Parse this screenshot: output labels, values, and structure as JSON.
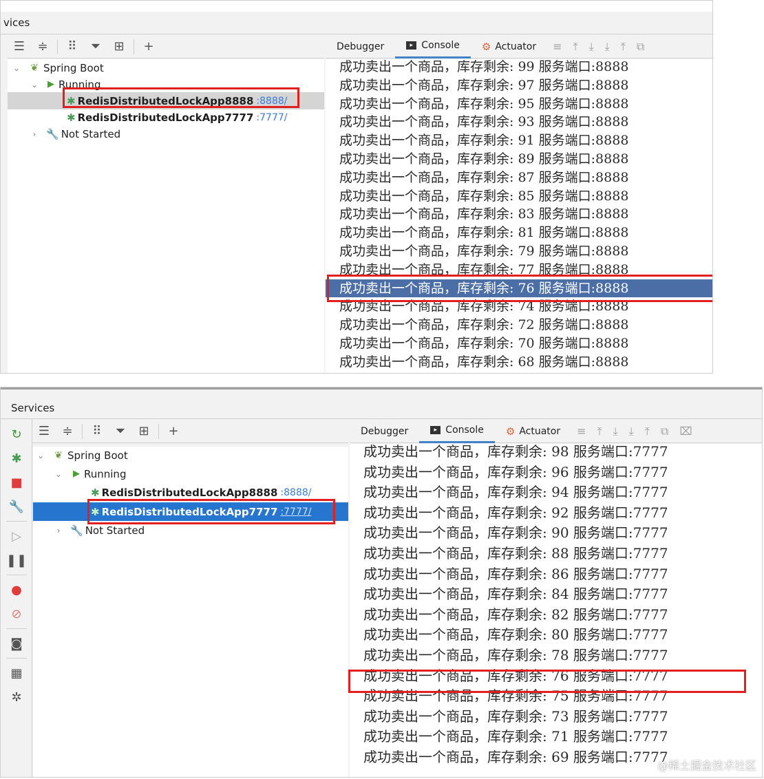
{
  "top": {
    "title": "vices",
    "tree": {
      "spring_boot": "Spring Boot",
      "running": "Running",
      "app1_name": "RedisDistributedLockApp8888",
      "app1_port": ":8888/",
      "app2_name": "RedisDistributedLockApp7777",
      "app2_port": ":7777/",
      "not_started": "Not Started"
    },
    "tabs": {
      "debugger": "Debugger",
      "console": "Console",
      "actuator": "Actuator"
    },
    "console_lines": [
      "成功卖出一个商品，库存剩余: 99 服务端口:8888",
      "成功卖出一个商品，库存剩余: 97 服务端口:8888",
      "成功卖出一个商品，库存剩余: 95 服务端口:8888",
      "成功卖出一个商品，库存剩余: 93 服务端口:8888",
      "成功卖出一个商品，库存剩余: 91 服务端口:8888",
      "成功卖出一个商品，库存剩余: 89 服务端口:8888",
      "成功卖出一个商品，库存剩余: 87 服务端口:8888",
      "成功卖出一个商品，库存剩余: 85 服务端口:8888",
      "成功卖出一个商品，库存剩余: 83 服务端口:8888",
      "成功卖出一个商品，库存剩余: 81 服务端口:8888",
      "成功卖出一个商品，库存剩余: 79 服务端口:8888",
      "成功卖出一个商品，库存剩余: 77 服务端口:8888",
      "成功卖出一个商品，库存剩余: 76 服务端口:8888",
      "成功卖出一个商品，库存剩余: 74 服务端口:8888",
      "成功卖出一个商品，库存剩余: 72 服务端口:8888",
      "成功卖出一个商品，库存剩余: 70 服务端口:8888",
      "成功卖出一个商品，库存剩余: 68 服务端口:8888"
    ]
  },
  "bottom": {
    "title": "Services",
    "tree": {
      "spring_boot": "Spring Boot",
      "running": "Running",
      "app1_name": "RedisDistributedLockApp8888",
      "app1_port": ":8888/",
      "app2_name": "RedisDistributedLockApp7777",
      "app2_port": ":7777/",
      "not_started": "Not Started"
    },
    "tabs": {
      "debugger": "Debugger",
      "console": "Console",
      "actuator": "Actuator"
    },
    "console_lines": [
      "成功卖出一个商品，库存剩余: 98 服务端口:7777",
      "成功卖出一个商品，库存剩余: 96 服务端口:7777",
      "成功卖出一个商品，库存剩余: 94 服务端口:7777",
      "成功卖出一个商品，库存剩余: 92 服务端口:7777",
      "成功卖出一个商品，库存剩余: 90 服务端口:7777",
      "成功卖出一个商品，库存剩余: 88 服务端口:7777",
      "成功卖出一个商品，库存剩余: 86 服务端口:7777",
      "成功卖出一个商品，库存剩余: 84 服务端口:7777",
      "成功卖出一个商品，库存剩余: 82 服务端口:7777",
      "成功卖出一个商品，库存剩余: 80 服务端口:7777",
      "成功卖出一个商品，库存剩余: 78 服务端口:7777",
      "成功卖出一个商品，库存剩余: 76 服务端口:7777",
      "成功卖出一个商品，库存剩余: 75 服务端口:7777",
      "成功卖出一个商品，库存剩余: 73 服务端口:7777",
      "成功卖出一个商品，库存剩余: 71 服务端口:7777",
      "成功卖出一个商品，库存剩余: 69 服务端口:7777"
    ]
  },
  "watermark": "@稀土掘金技术社区",
  "colors": {
    "highlight_row": "#4c6ea6",
    "selection_blue": "#2675cf",
    "red_annotation": "#e21f1f",
    "port_link": "#3a7ad6"
  }
}
